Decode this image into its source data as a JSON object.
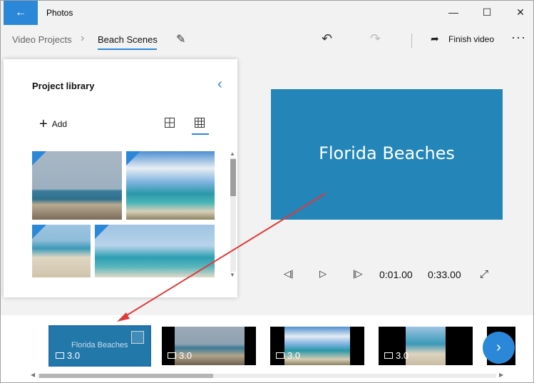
{
  "window": {
    "title": "Photos",
    "back_icon": "arrow-left-icon",
    "minimize": "—",
    "maximize": "☐",
    "close": "✕"
  },
  "toolbar": {
    "breadcrumb_parent": "Video Projects",
    "breadcrumb_current": "Beach Scenes",
    "finish_label": "Finish video",
    "more": "···"
  },
  "library": {
    "title": "Project library",
    "add_label": "Add"
  },
  "preview": {
    "title_text": "Florida Beaches",
    "current_time": "0:01.00",
    "total_time": "0:33.00"
  },
  "storyboard": {
    "cards": [
      {
        "title": "Florida Beaches",
        "duration": "3.0"
      },
      {
        "duration": "3.0"
      },
      {
        "duration": "3.0"
      },
      {
        "duration": "3.0"
      }
    ]
  },
  "colors": {
    "accent": "#2b88d8",
    "preview_bg": "#2485b9",
    "annotation_arrow": "#e03a3a"
  }
}
